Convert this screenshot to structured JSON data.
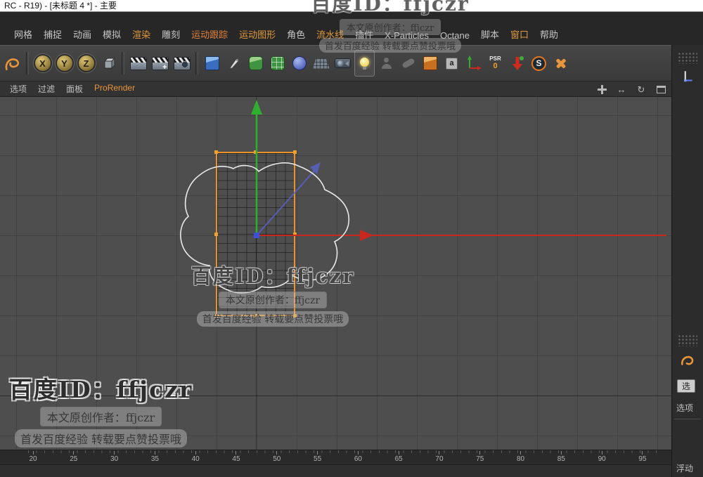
{
  "title_bar": {
    "title": "RC - R19) - [未标题 4 *] - 主要"
  },
  "menu_bar": {
    "items": [
      {
        "label": "网格",
        "color": "#c6c6c6"
      },
      {
        "label": "捕捉",
        "color": "#c6c6c6"
      },
      {
        "label": "动画",
        "color": "#c6c6c6"
      },
      {
        "label": "模拟",
        "color": "#c6c6c6"
      },
      {
        "label": "渲染",
        "color": "#e09a3c"
      },
      {
        "label": "雕刻",
        "color": "#c6c6c6"
      },
      {
        "label": "运动跟踪",
        "color": "#e0823c"
      },
      {
        "label": "运动图形",
        "color": "#e09a3c"
      },
      {
        "label": "角色",
        "color": "#c6c6c6"
      },
      {
        "label": "流水线",
        "color": "#e09a3c"
      },
      {
        "label": "插件",
        "color": "#c6c6c6"
      },
      {
        "label": "X-Particles",
        "color": "#c6c6c6"
      },
      {
        "label": "Octane",
        "color": "#c6c6c6"
      },
      {
        "label": "脚本",
        "color": "#c6c6c6"
      },
      {
        "label": "窗口",
        "color": "#e09a3c"
      },
      {
        "label": "帮助",
        "color": "#c6c6c6"
      }
    ]
  },
  "toolbar": {
    "axis_x_label": "X",
    "axis_y_label": "Y",
    "axis_z_label": "Z",
    "material_tag_label": "a",
    "psr_label": "PSR",
    "psr_value": "0",
    "substance_label": "S"
  },
  "viewport_menu": {
    "items": [
      {
        "label": "选项",
        "color": "#c0c0c0"
      },
      {
        "label": "过滤",
        "color": "#c0c0c0"
      },
      {
        "label": "面板",
        "color": "#c0c0c0"
      },
      {
        "label": "ProRender",
        "color": "#e8963c"
      }
    ]
  },
  "watermark": {
    "line1": "百度ID：ffjczr",
    "line2": "本文原创作者：ffjczr",
    "line3": "首发百度经验 转载要点赞投票哦"
  },
  "timeline": {
    "ticks": [
      "20",
      "25",
      "30",
      "35",
      "40",
      "45",
      "50",
      "55",
      "60",
      "65",
      "70",
      "75",
      "80",
      "85",
      "90",
      "95"
    ]
  },
  "right_panel": {
    "tab_label": "选",
    "options_label": "选项",
    "bottom_label": "浮动"
  },
  "colors": {
    "accent_orange": "#e8963c",
    "axis_green": "#2fae2f",
    "axis_red": "#c8281e",
    "axis_blue": "#3c50d8",
    "object_orange": "#e8932a",
    "viewport_bg": "#4e4e4e"
  }
}
